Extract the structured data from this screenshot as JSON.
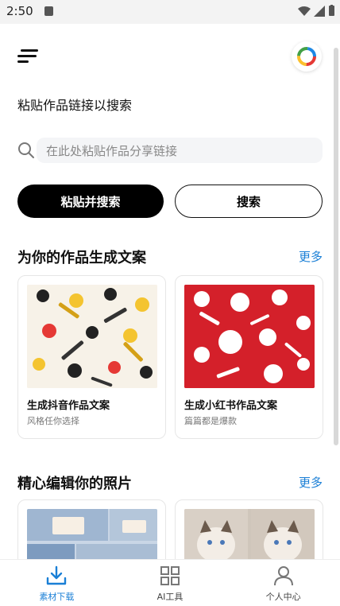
{
  "status_bar": {
    "time": "2:50"
  },
  "header": {
    "title": "粘贴作品链接以搜索"
  },
  "search": {
    "placeholder": "在此处粘贴作品分享链接"
  },
  "buttons": {
    "paste_search": "粘贴并搜索",
    "search": "搜索"
  },
  "section1": {
    "title": "为你的作品生成文案",
    "more": "更多",
    "cards": [
      {
        "title": "生成抖音作品文案",
        "subtitle": "风格任你选择"
      },
      {
        "title": "生成小红书作品文案",
        "subtitle": "篇篇都是爆款"
      }
    ]
  },
  "section2": {
    "title": "精心编辑你的照片",
    "more": "更多"
  },
  "bottom_nav": {
    "items": [
      {
        "label": "素材下载",
        "icon": "download-icon",
        "active": true
      },
      {
        "label": "AI工具",
        "icon": "grid-icon",
        "active": false
      },
      {
        "label": "个人中心",
        "icon": "user-icon",
        "active": false
      }
    ]
  },
  "colors": {
    "accent": "#1a7fd6",
    "primary_button": "#000000",
    "card2_bg": "#d4202a"
  }
}
